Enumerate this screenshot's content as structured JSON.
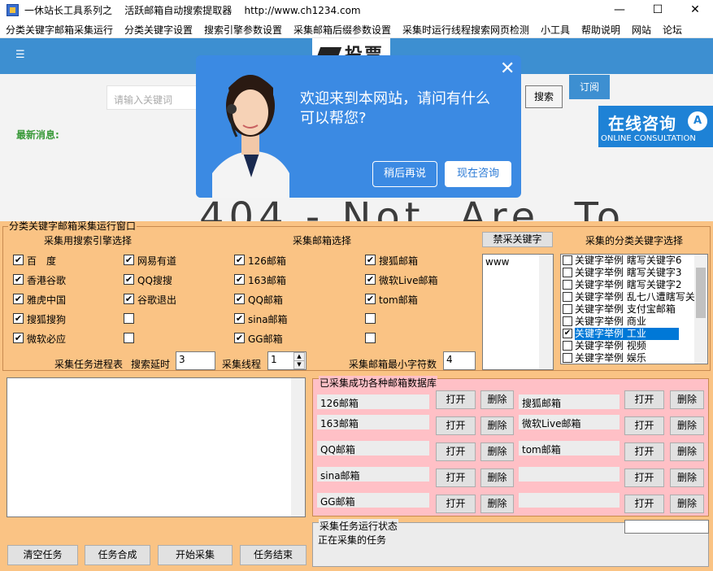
{
  "window": {
    "title": "一休站长工具系列之    活跃邮箱自动搜索提取器    http://www.ch1234.com",
    "minimize": "—",
    "maximize": "☐",
    "close": "✕"
  },
  "menu": [
    "分类关键字邮箱采集运行",
    "分类关键字设置",
    "搜索引擎参数设置",
    "采集邮箱后缀参数设置",
    "采集时运行线程搜索网页检测",
    "小工具",
    "帮助说明",
    "网站",
    "论坛"
  ],
  "web": {
    "logo_text": "投票",
    "search_placeholder": "请输入关键词",
    "search_button": "搜索",
    "subscribe_button": "订阅",
    "news_label": "最新消息:",
    "big_text": "404 - Not  Are  To",
    "consult_title": "在线咨询",
    "consult_sub": "ONLINE CONSULTATION",
    "consult_icon": "A",
    "popup": {
      "message": "欢迎来到本网站，请问有什么可以帮您?",
      "close": "✕",
      "later": "稍后再说",
      "now": "现在咨询"
    }
  },
  "app": {
    "main_group": "分类关键字邮箱采集运行窗口",
    "engine_header": "采集用搜索引擎选择",
    "mailbox_header": "采集邮箱选择",
    "ban_button": "禁采关键字",
    "keyword_header": "采集的分类关键字选择",
    "engines": [
      {
        "label": "百　度",
        "checked": true
      },
      {
        "label": "网易有道",
        "checked": true
      },
      {
        "label": "香港谷歌",
        "checked": true
      },
      {
        "label": "QQ搜搜",
        "checked": true
      },
      {
        "label": "雅虎中国",
        "checked": true
      },
      {
        "label": "谷歌退出",
        "checked": true
      },
      {
        "label": "搜狐搜狗",
        "checked": true
      },
      {
        "label": "",
        "checked": false
      },
      {
        "label": "微软必应",
        "checked": true
      },
      {
        "label": "",
        "checked": false
      }
    ],
    "mailboxes": [
      {
        "label": "126邮箱",
        "checked": true
      },
      {
        "label": "搜狐邮箱",
        "checked": true
      },
      {
        "label": "163邮箱",
        "checked": true
      },
      {
        "label": "微软Live邮箱",
        "checked": true
      },
      {
        "label": "QQ邮箱",
        "checked": true
      },
      {
        "label": "tom邮箱",
        "checked": true
      },
      {
        "label": "sina邮箱",
        "checked": true
      },
      {
        "label": "",
        "checked": false
      },
      {
        "label": "GG邮箱",
        "checked": true
      },
      {
        "label": "",
        "checked": false
      }
    ],
    "ban_text": "www",
    "keywords": [
      {
        "label": "关键字举例  瞎写关键字6",
        "checked": false,
        "selected": false
      },
      {
        "label": "关键字举例  瞎写关键字3",
        "checked": false,
        "selected": false
      },
      {
        "label": "关键字举例  瞎写关键字2",
        "checked": false,
        "selected": false
      },
      {
        "label": "关键字举例  乱七八遭瞎写关",
        "checked": false,
        "selected": false
      },
      {
        "label": "关键字举例  支付宝邮箱",
        "checked": false,
        "selected": false
      },
      {
        "label": "关键字举例  商业",
        "checked": false,
        "selected": false
      },
      {
        "label": "关键字举例  工业",
        "checked": true,
        "selected": true
      },
      {
        "label": "关键字举例  视频",
        "checked": false,
        "selected": false
      },
      {
        "label": "关键字举例  娱乐",
        "checked": false,
        "selected": false
      }
    ],
    "progress_label": "采集任务进程表",
    "delay_label": "搜索延时",
    "delay_value": "3",
    "thread_label": "采集线程",
    "thread_value": "1",
    "min_chars_label": "采集邮箱最小字符数",
    "min_chars_value": "4",
    "db_group": "已采集成功各种邮箱数据库",
    "db_left": [
      "126邮箱",
      "163邮箱",
      "QQ邮箱",
      "sina邮箱",
      "GG邮箱"
    ],
    "db_right": [
      "搜狐邮箱",
      "微软Live邮箱",
      "tom邮箱",
      "",
      ""
    ],
    "open_label": "打开",
    "delete_label": "删除",
    "status_group": "采集任务运行状态",
    "status_text": "正在采集的任务",
    "buttons": {
      "clear": "清空任务",
      "merge": "任务合成",
      "start": "开始采集",
      "end": "任务结束"
    }
  }
}
